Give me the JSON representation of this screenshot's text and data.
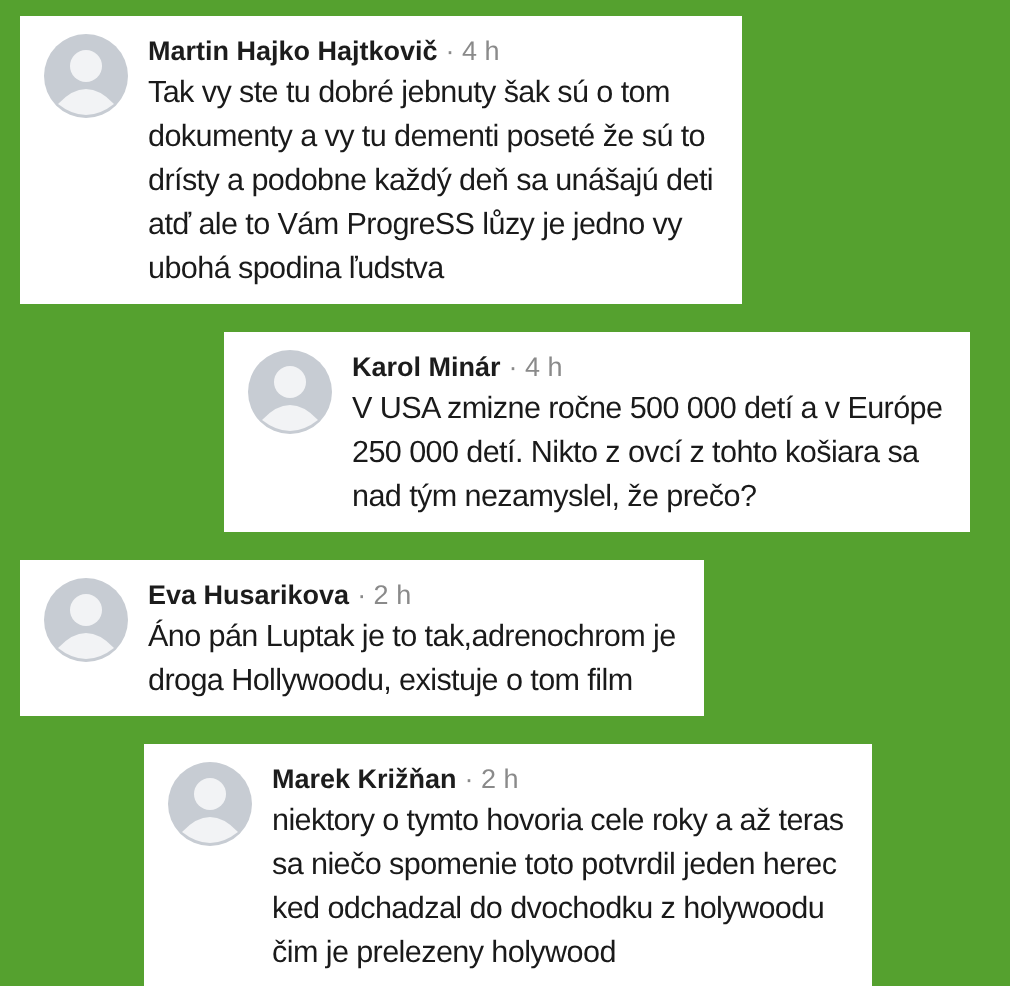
{
  "comments": [
    {
      "kind": "comment",
      "author": "Martin Hajko Hajtkovič",
      "time": "· 4 h",
      "text": "Tak vy ste tu dobré jebnuty šak sú o tom\ndokumenty a vy tu dementi poseté že sú to\ndrísty a podobne každý deň sa unášajú deti\natď ale to Vám ProgreSS lůzy je jedno vy\nubohá spodina ľudstva"
    },
    {
      "kind": "reply",
      "author": "Karol Minár",
      "time": "· 4 h",
      "text": "V USA zmizne ročne 500 000 detí a v Európe\n250 000 detí. Nikto z ovcí z tohto košiara sa\nnad tým nezamyslel, že prečo?"
    },
    {
      "kind": "comment",
      "author": "Eva Husarikova",
      "time": "· 2 h",
      "text": "Áno pán Luptak je to tak,adrenochrom je\ndroga Hollywoodu, existuje o tom film"
    },
    {
      "kind": "reply",
      "author": "Marek Križňan",
      "time": "· 2 h",
      "text": "niektory o tymto hovoria cele roky a až teras\nsa niečo spomenie toto potvrdil jeden herec\nked odchadzal do dvochodku z holywoodu\nčim je prelezeny holywood"
    }
  ]
}
